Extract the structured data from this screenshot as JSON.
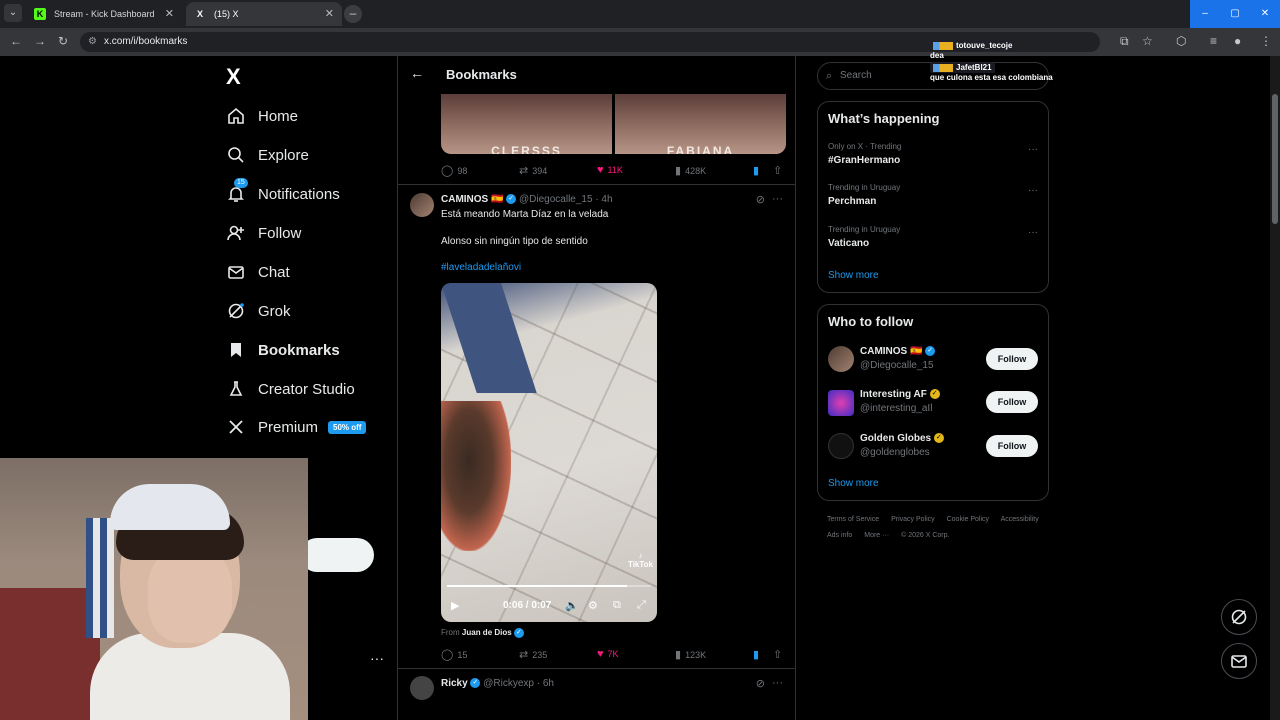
{
  "browser": {
    "tabs": [
      {
        "label": "Stream - Kick Dashboard",
        "favicon": "K"
      },
      {
        "label": "(15) X",
        "favicon": "X"
      }
    ],
    "url": "x.com/i/bookmarks"
  },
  "sidebar": {
    "logo": "X",
    "items": [
      {
        "label": "Home",
        "icon": "home-icon"
      },
      {
        "label": "Explore",
        "icon": "search-icon"
      },
      {
        "label": "Notifications",
        "icon": "bell-icon",
        "badge": "15"
      },
      {
        "label": "Follow",
        "icon": "person-plus-icon"
      },
      {
        "label": "Chat",
        "icon": "envelope-icon"
      },
      {
        "label": "Grok",
        "icon": "grok-icon"
      },
      {
        "label": "Bookmarks",
        "icon": "bookmark-icon"
      },
      {
        "label": "Creator Studio",
        "icon": "flask-icon"
      },
      {
        "label": "Premium",
        "icon": "x-icon",
        "badge": "50% off"
      }
    ]
  },
  "feed": {
    "title": "Bookmarks",
    "prev_tweet": {
      "image_captions": [
        "CLERSSS",
        "FABIANA"
      ],
      "replies": "98",
      "reposts": "394",
      "likes": "11K",
      "views": "428K"
    },
    "tweet": {
      "name": "CAMINOS 🇪🇸",
      "handle": "@Diegocalle_15",
      "time": "· 4h",
      "line1": "Está meando Marta Díaz en la velada",
      "line2": "Alonso sin ningún tipo de sentido",
      "hashtag": "#laveladadelañovi",
      "video_time": "0:06 / 0:07",
      "video_progress": 0.88,
      "watermark": "TikTok",
      "from_label": "From",
      "from_name": "Juan de Dios",
      "replies": "15",
      "reposts": "235",
      "likes": "7K",
      "views": "123K"
    },
    "next_tweet": {
      "name": "Ricky",
      "handle": "@Rickyexp",
      "time": "· 6h"
    }
  },
  "right": {
    "search_placeholder": "Search",
    "happening": {
      "title": "What’s happening",
      "trends": [
        {
          "meta": "Only on X · Trending",
          "name": "#GranHermano"
        },
        {
          "meta": "Trending in Uruguay",
          "name": "Perchman"
        },
        {
          "meta": "Trending in Uruguay",
          "name": "Vaticano"
        }
      ],
      "show_more": "Show more"
    },
    "who_to_follow": {
      "title": "Who to follow",
      "accounts": [
        {
          "name": "CAMINOS 🇪🇸",
          "handle": "@Diegocalle_15",
          "button": "Follow"
        },
        {
          "name": "Interesting AF",
          "handle": "@interesting_aIl",
          "button": "Follow"
        },
        {
          "name": "Golden Globes",
          "handle": "@goldenglobes",
          "button": "Follow"
        }
      ],
      "show_more": "Show more"
    },
    "footer": [
      "Terms of Service",
      "Privacy Policy",
      "Cookie Policy",
      "Accessibility",
      "Ads info",
      "More ···",
      "© 2026 X Corp."
    ]
  },
  "chat": [
    {
      "user": "totouve_tecoje",
      "message": "dea"
    },
    {
      "user": "JafetBl21",
      "message": "que culona esta esa colombiana"
    }
  ]
}
